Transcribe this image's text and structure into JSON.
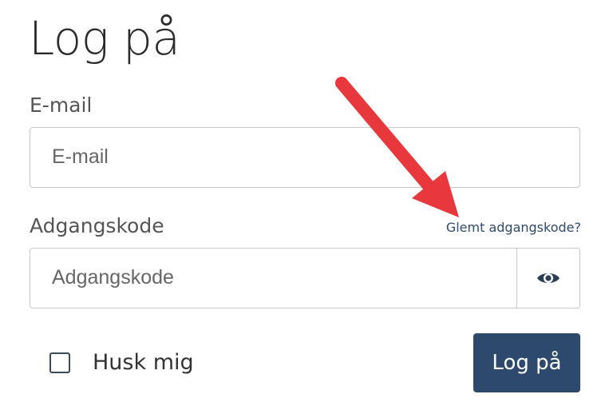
{
  "page": {
    "title": "Log på"
  },
  "form": {
    "email_label": "E-mail",
    "email_placeholder": "E-mail",
    "password_label": "Adgangskode",
    "password_placeholder": "Adgangskode",
    "forgot_link": "Glemt adgangskode?",
    "password_toggle_icon": "eye-icon",
    "remember_label": "Husk mig",
    "remember_checked": false,
    "submit_label": "Log på"
  },
  "annotation": {
    "arrow_color": "#e8383d"
  },
  "colors": {
    "accent": "#2d4a6d",
    "link": "#2e4a6e"
  }
}
